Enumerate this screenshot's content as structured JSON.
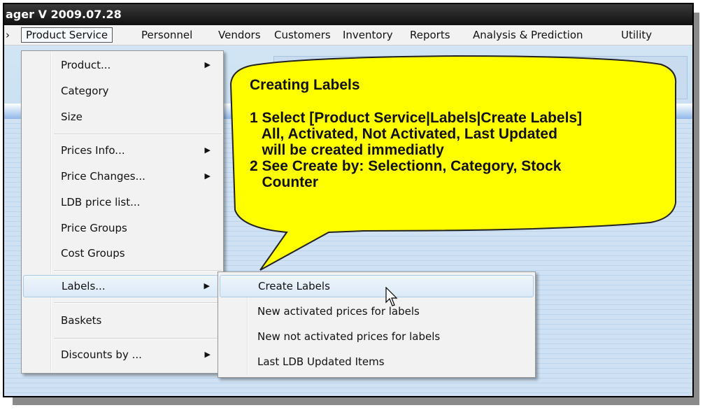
{
  "window": {
    "title": "ager V 2009.07.28"
  },
  "menubar": {
    "items": [
      {
        "label": "›"
      },
      {
        "label": "Product Service"
      },
      {
        "label": "Personnel"
      },
      {
        "label": "Vendors"
      },
      {
        "label": "Customers"
      },
      {
        "label": "Inventory"
      },
      {
        "label": "Reports"
      },
      {
        "label": "Analysis & Prediction"
      },
      {
        "label": "Utility"
      }
    ]
  },
  "product_menu": {
    "items": [
      {
        "label": "Product..."
      },
      {
        "label": "Category"
      },
      {
        "label": "Size"
      },
      {
        "label": "Prices Info..."
      },
      {
        "label": "Price Changes..."
      },
      {
        "label": "LDB price list..."
      },
      {
        "label": "Price Groups"
      },
      {
        "label": "Cost Groups"
      },
      {
        "label": "Labels..."
      },
      {
        "label": "Baskets"
      },
      {
        "label": "Discounts by ..."
      }
    ]
  },
  "labels_submenu": {
    "items": [
      {
        "label": "Create Labels"
      },
      {
        "label": "New activated prices for labels"
      },
      {
        "label": "New not activated prices for labels"
      },
      {
        "label": "Last LDB Updated Items"
      }
    ]
  },
  "callout": {
    "title": "Creating Labels",
    "lines": [
      "1 Select [Product Service|Labels|Create Labels]",
      "   All, Activated, Not Activated, Last Updated",
      "   will be created immediatly",
      "2 See Create by: Selectionn, Category, Stock",
      "   Counter"
    ],
    "fill_color": "#ffff00"
  },
  "icons": {
    "submenu_arrow": "triangle-right-icon",
    "cursor": "mouse-pointer-icon"
  }
}
